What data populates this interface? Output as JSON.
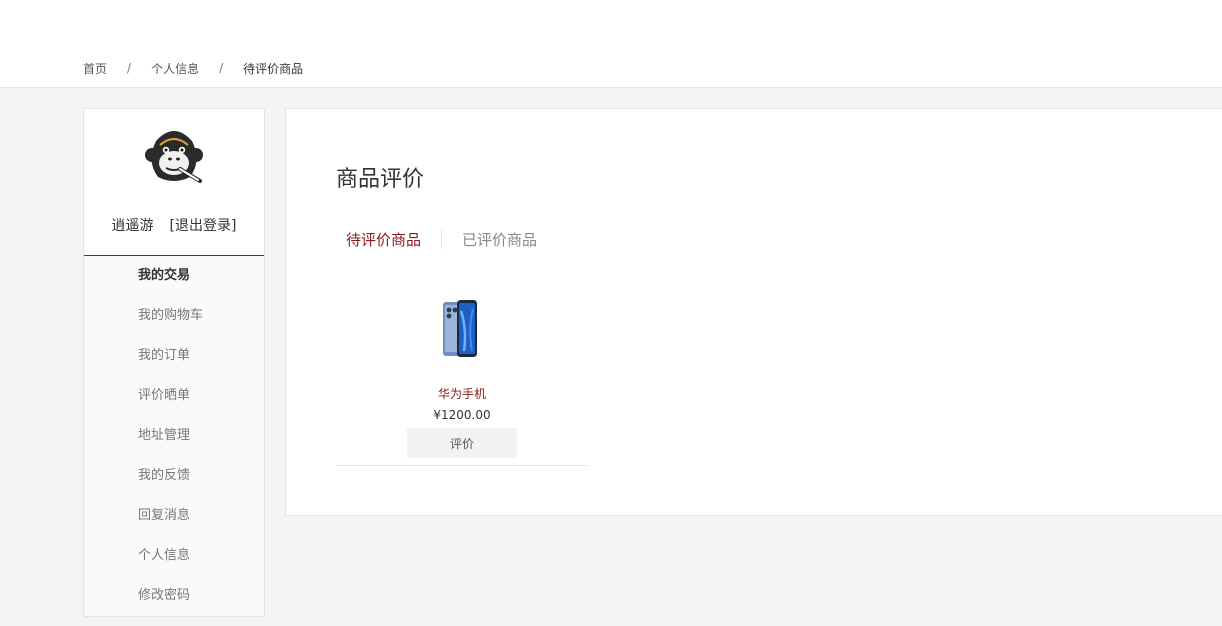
{
  "breadcrumb": {
    "items": [
      "首页",
      "个人信息",
      "待评价商品"
    ],
    "separator": "/"
  },
  "sidebar": {
    "username": "逍遥游",
    "logout_label": "[退出登录]",
    "menu": [
      "我的交易",
      "我的购物车",
      "我的订单",
      "评价晒单",
      "地址管理",
      "我的反馈",
      "回复消息",
      "个人信息",
      "修改密码"
    ],
    "avatar_icon": "gorilla-avatar-icon"
  },
  "main": {
    "title": "商品评价",
    "tabs": [
      "待评价商品",
      "已评价商品"
    ],
    "products": [
      {
        "name": "华为手机",
        "price": "¥1200.00",
        "action_label": "评价",
        "image_icon": "phone-image-icon"
      }
    ]
  },
  "colors": {
    "accent": "#8b1a1a",
    "page_background": "#f4f4f4",
    "button_background": "#f2f2f2"
  }
}
